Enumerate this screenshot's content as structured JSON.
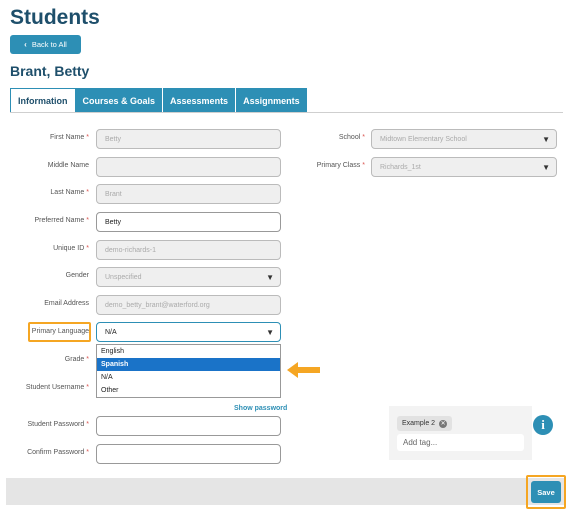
{
  "page": {
    "title": "Students"
  },
  "back_button": {
    "label": "Back to All"
  },
  "student": {
    "name": "Brant, Betty"
  },
  "tabs": [
    {
      "label": "Information",
      "active": true
    },
    {
      "label": "Courses & Goals",
      "active": false
    },
    {
      "label": "Assessments",
      "active": false
    },
    {
      "label": "Assignments",
      "active": false
    }
  ],
  "form": {
    "first_name": {
      "label": "First Name",
      "required": "*",
      "value": "Betty"
    },
    "middle_name": {
      "label": "Middle Name",
      "value": ""
    },
    "last_name": {
      "label": "Last Name",
      "required": "*",
      "value": "Brant"
    },
    "preferred_name": {
      "label": "Preferred Name",
      "required": "*",
      "value": "Betty"
    },
    "unique_id": {
      "label": "Unique ID",
      "required": "*",
      "value": "demo-richards-1"
    },
    "gender": {
      "label": "Gender",
      "value": "Unspecified"
    },
    "email": {
      "label": "Email Address",
      "value": "demo_betty_brant@waterford.org"
    },
    "primary_language": {
      "label": "Primary Language",
      "value": "N/A",
      "options": [
        "English",
        "Spanish",
        "N/A",
        "Other"
      ],
      "highlighted_option": "Spanish"
    },
    "grade": {
      "label": "Grade",
      "required": "*"
    },
    "student_username": {
      "label": "Student Username",
      "required": "*"
    },
    "show_password": "Show password",
    "student_password": {
      "label": "Student Password",
      "required": "*",
      "value": ""
    },
    "confirm_password": {
      "label": "Confirm Password",
      "required": "*",
      "value": ""
    },
    "school": {
      "label": "School",
      "required": "*",
      "value": "Midtown Elementary School"
    },
    "primary_class": {
      "label": "Primary Class",
      "required": "*",
      "value": "Richards_1st"
    }
  },
  "tags": {
    "chip": "Example 2",
    "placeholder": "Add tag..."
  },
  "info_icon": "i",
  "footer": {
    "save_label": "Save"
  },
  "colors": {
    "brand": "#2d8fb5",
    "title": "#1e4f6b",
    "highlight": "#f5a623",
    "selected_option": "#1a73c8"
  },
  "icons": [
    "chevron-left-icon",
    "caret-down-icon",
    "arrow-left-icon",
    "remove-tag-icon",
    "info-icon"
  ]
}
